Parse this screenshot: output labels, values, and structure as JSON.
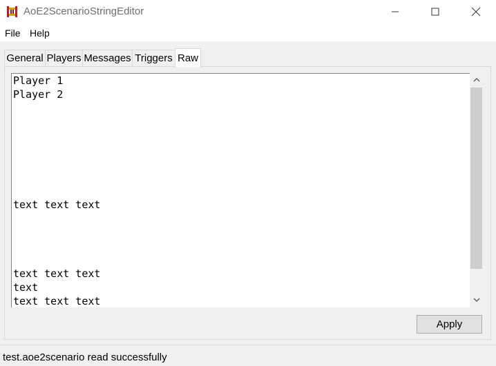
{
  "window": {
    "title": "AoE2ScenarioStringEditor",
    "icon": "aoe2-app-icon",
    "minimize_icon": "minimize-icon",
    "maximize_icon": "maximize-icon",
    "close_icon": "close-icon"
  },
  "menu": {
    "file": "File",
    "help": "Help"
  },
  "tabs": [
    {
      "label": "General"
    },
    {
      "label": "Players"
    },
    {
      "label": "Messages"
    },
    {
      "label": "Triggers"
    },
    {
      "label": "Raw"
    }
  ],
  "active_tab": "Raw",
  "editor": {
    "lines": [
      "Player 1",
      "Player 2",
      "",
      "",
      "",
      "",
      "",
      "",
      "",
      "text text text",
      "",
      "",
      "",
      "",
      "text text text",
      "text",
      "text text text"
    ]
  },
  "apply_label": "Apply",
  "status": "test.aoe2scenario read successfully",
  "colors": {
    "scroll_thumb": "#cdcdcd",
    "window_bg": "#f0f0f0",
    "button_bg": "#e1e1e1"
  }
}
